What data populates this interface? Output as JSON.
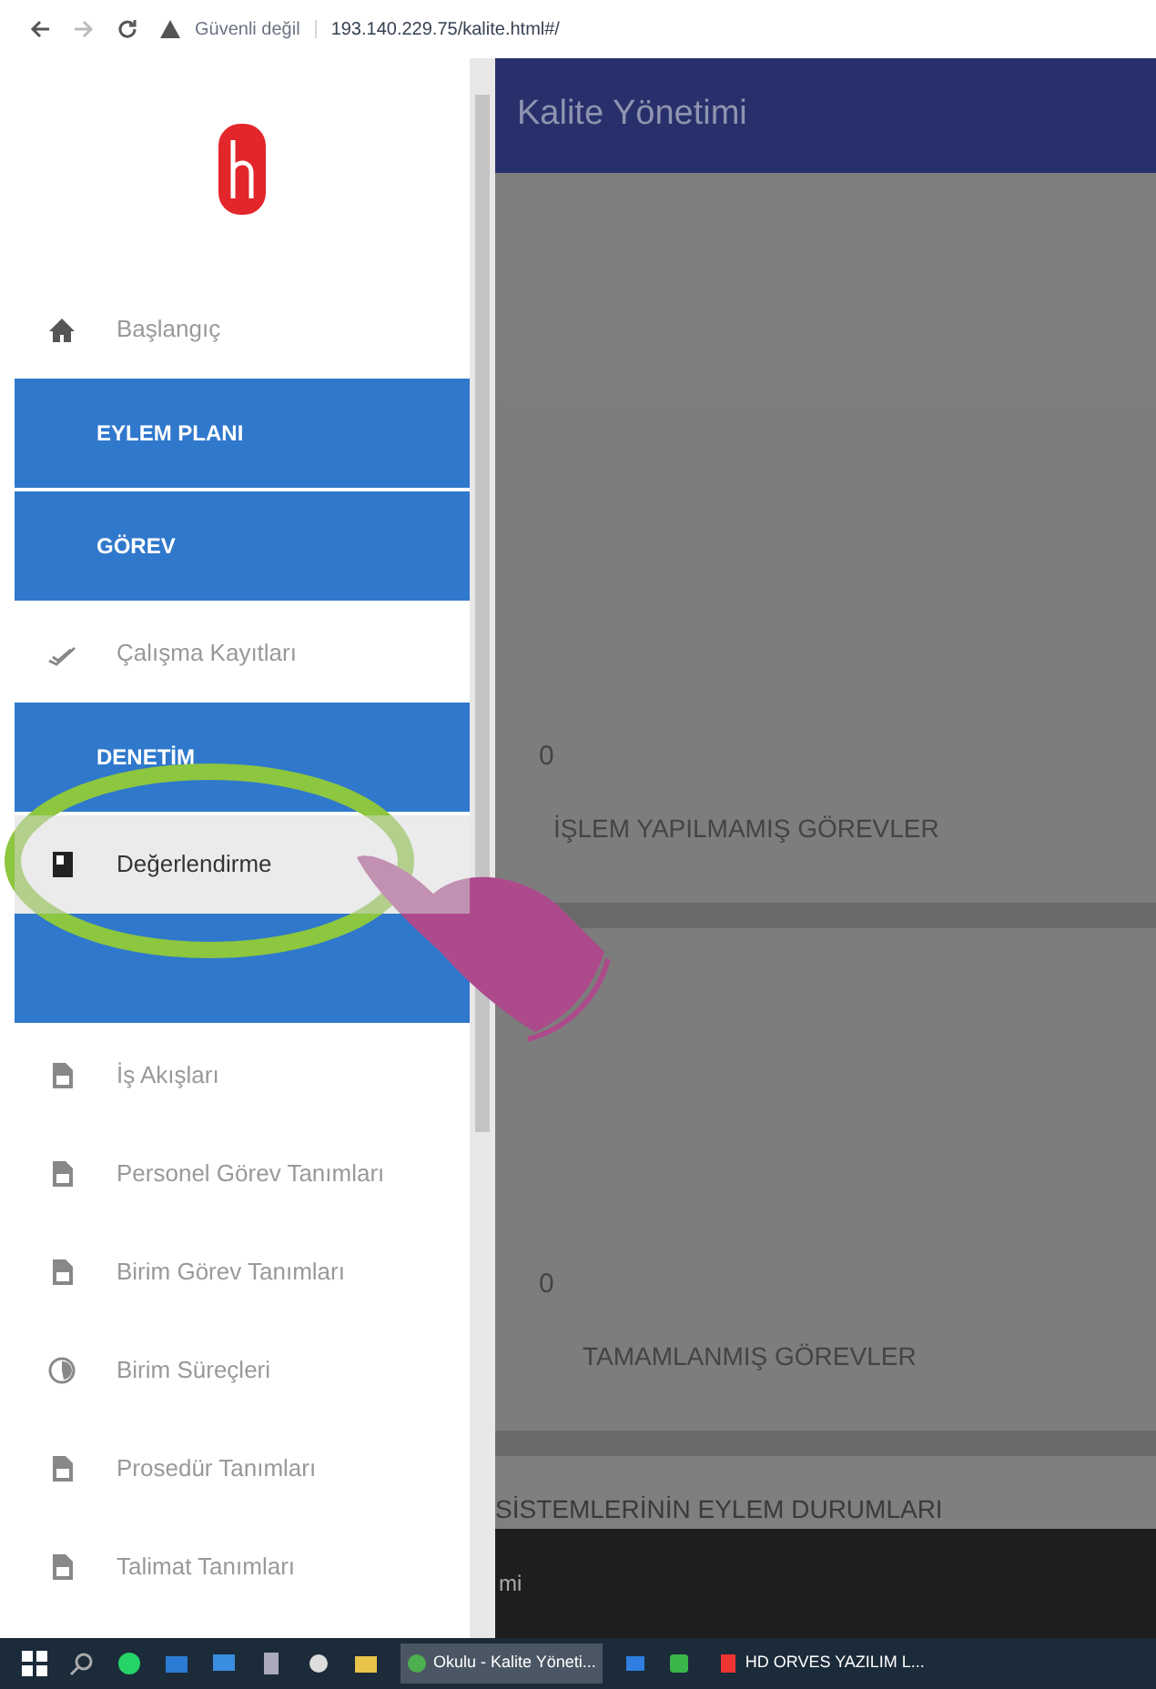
{
  "browser": {
    "security": "Güvenli değil",
    "url": "193.140.229.75/kalite.html#/"
  },
  "header": {
    "title": "Kalite Yönetimi"
  },
  "sidebar": {
    "items": [
      {
        "kind": "link",
        "label": "Başlangıç",
        "selected": false
      },
      {
        "kind": "section",
        "label": "EYLEM PLANI",
        "selected": false
      },
      {
        "kind": "section",
        "label": "GÖREV",
        "selected": false
      },
      {
        "kind": "link",
        "label": "Çalışma Kayıtları",
        "selected": false
      },
      {
        "kind": "section",
        "label": "DENETİM",
        "selected": false
      },
      {
        "kind": "link",
        "label": "Değerlendirme",
        "selected": true
      },
      {
        "kind": "section",
        "selected": false
      },
      {
        "kind": "link",
        "label": "İş Akışları",
        "selected": false
      },
      {
        "kind": "link",
        "label": "Personel Görev Tanımları",
        "selected": false
      },
      {
        "kind": "link",
        "label": "Birim Görev Tanımları",
        "selected": false
      },
      {
        "kind": "link",
        "label": "Birim Süreçleri",
        "selected": false
      },
      {
        "kind": "link",
        "label": "Prosedür Tanımları",
        "selected": false
      },
      {
        "kind": "link",
        "label": "Talimat Tanımları",
        "selected": false
      }
    ]
  },
  "cards": [
    {
      "count": "0",
      "label": "İŞLEM YAPILMAMIŞ GÖREVLER"
    },
    {
      "count": "0",
      "label": "TAMAMLANMIŞ GÖREVLER"
    }
  ],
  "section_title": "SİSTEMLERİNİN EYLEM DURUMLARI",
  "footer_text": "mi",
  "taskbar": {
    "windows": [
      {
        "label": "Okulu - Kalite Yöneti...",
        "selected": true
      },
      {
        "label": "HD ORVES YAZILIM L...",
        "selected": false
      }
    ]
  }
}
